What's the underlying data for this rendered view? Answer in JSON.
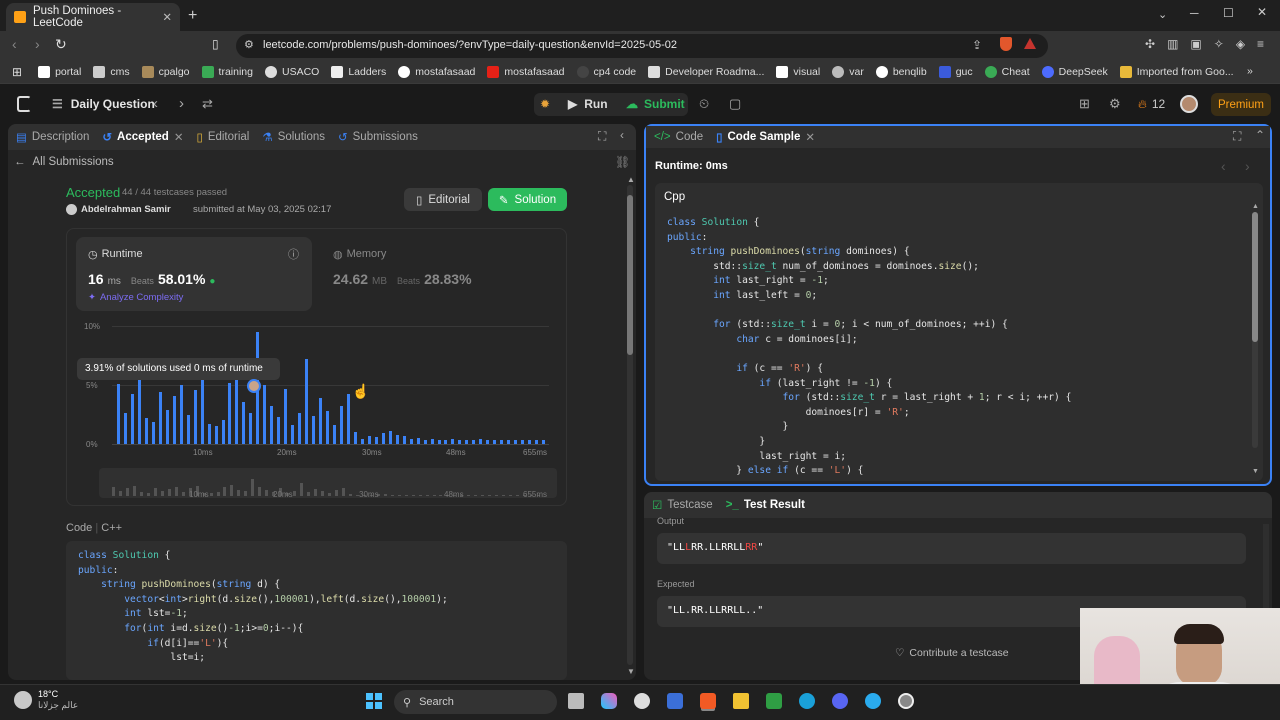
{
  "browser": {
    "tab_title": "Push Dominoes - LeetCode",
    "url": "leetcode.com/problems/push-dominoes/?envType=daily-question&envId=2025-05-02",
    "bookmarks": [
      "portal",
      "cms",
      "cpalgo",
      "training",
      "USACO",
      "Ladders",
      "mostafasaad",
      "mostafasaad",
      "cp4 code",
      "Developer Roadma...",
      "visual",
      "var",
      "benqlib",
      "guc",
      "Cheat",
      "DeepSeek",
      "Imported from Goo..."
    ]
  },
  "nav": {
    "daily": "Daily Question",
    "run": "Run",
    "submit": "Submit",
    "streak": "12",
    "premium": "Premium"
  },
  "left_tabs": [
    "Description",
    "Accepted",
    "Editorial",
    "Solutions",
    "Submissions"
  ],
  "submission": {
    "back": "All Submissions",
    "status": "Accepted",
    "testcases": "44 / 44 testcases passed",
    "user": "Abdelrahman Samir",
    "submitted": "submitted at May 03, 2025 02:17",
    "editorial_btn": "Editorial",
    "solution_btn": "Solution"
  },
  "stats": {
    "runtime_label": "Runtime",
    "runtime_value": "16",
    "runtime_unit": "ms",
    "beats_label": "Beats",
    "runtime_beats": "58.01%",
    "analyze": "Analyze Complexity",
    "memory_label": "Memory",
    "memory_value": "24.62",
    "memory_unit": "MB",
    "memory_beats": "28.83%"
  },
  "chart": {
    "y_ticks": [
      "10%",
      "5%",
      "0%"
    ],
    "x_ticks": [
      "10ms",
      "20ms",
      "30ms",
      "48ms",
      "655ms"
    ],
    "tooltip": "3.91% of solutions used 0 ms of runtime"
  },
  "chart_data": {
    "type": "bar",
    "ylim": [
      0,
      10
    ],
    "values": [
      5.1,
      2.6,
      4.2,
      5.8,
      2.2,
      1.9,
      4.4,
      2.9,
      4.1,
      5.0,
      2.5,
      4.6,
      5.6,
      1.7,
      1.5,
      2.0,
      5.2,
      6.0,
      3.6,
      2.6,
      9.5,
      5.0,
      3.2,
      2.3,
      4.7,
      1.6,
      2.6,
      7.2,
      2.4,
      3.9,
      2.8,
      1.6,
      3.2,
      4.2,
      1.0,
      0.4,
      0.7,
      0.6,
      0.9,
      1.1,
      0.8,
      0.7,
      0.4,
      0.5,
      0.3,
      0.4,
      0.3,
      0.3,
      0.4,
      0.3,
      0.3,
      0.3,
      0.4,
      0.3,
      0.3,
      0.3,
      0.3,
      0.3,
      0.3,
      0.3,
      0.3,
      0.3
    ]
  },
  "code_left": {
    "label": "Code",
    "lang": "C++"
  },
  "right_tabs": [
    "Code",
    "Code Sample"
  ],
  "sample": {
    "runtime": "Runtime: 0ms",
    "lang": "Cpp"
  },
  "bottom_tabs": [
    "Testcase",
    "Test Result"
  ],
  "result": {
    "output_label": "Output",
    "output_a": "\"LL",
    "output_b": "L",
    "output_c": "RR.LLRRLL",
    "output_d": "RR",
    "output_e": "\"",
    "expected_label": "Expected",
    "expected": "\"LL.RR.LLRRLL..\"",
    "contribute": "Contribute a testcase"
  },
  "taskbar": {
    "temp": "18°C",
    "location": "عالم جزلانا",
    "search": "Search"
  }
}
